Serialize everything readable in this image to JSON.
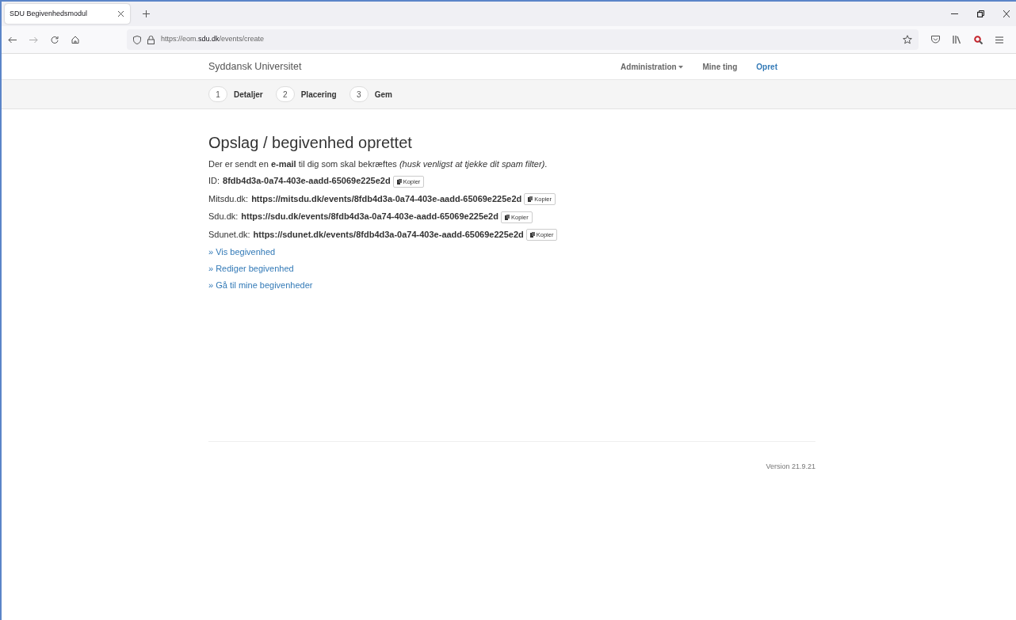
{
  "browser": {
    "tab_title": "SDU Begivenhedsmodul",
    "url": "https://eom.**sdu.dk**/events/create"
  },
  "navbar": {
    "brand": "Syddansk Universitet",
    "items": [
      {
        "label": "Administration",
        "dropdown": true,
        "selected": false
      },
      {
        "label": "Mine ting",
        "dropdown": false,
        "selected": false
      },
      {
        "label": "Opret",
        "dropdown": false,
        "selected": true
      }
    ]
  },
  "steps": [
    {
      "number": "1",
      "label": "Detaljer"
    },
    {
      "number": "2",
      "label": "Placering"
    },
    {
      "number": "3",
      "label": "Gem"
    }
  ],
  "heading": "Opslag / begivenhed oprettet",
  "message": "Der er sendt en **e-mail** til dig som skal bekræftes *(husk venligst at tjekke dit spam filter)*.",
  "details": [
    {
      "label": "ID:",
      "value": "8fdb4d3a-0a74-403e-aadd-65069e225e2d",
      "button": "Kopier"
    },
    {
      "label": "Mitsdu.dk:",
      "value": "https://mitsdu.dk/events/8fdb4d3a-0a74-403e-aadd-65069e225e2d",
      "button": "Kopier"
    },
    {
      "label": "Sdu.dk:",
      "value": "https://sdu.dk/events/8fdb4d3a-0a74-403e-aadd-65069e225e2d",
      "button": "Kopier"
    },
    {
      "label": "Sdunet.dk:",
      "value": "https://sdunet.dk/events/8fdb4d3a-0a74-403e-aadd-65069e225e2d",
      "button": "Kopier"
    }
  ],
  "links": [
    "» Vis begivenhed",
    "» Rediger begivenhed",
    "» Gå til mine begivenheder"
  ],
  "footer": {
    "version": "Version 21.9.21"
  }
}
